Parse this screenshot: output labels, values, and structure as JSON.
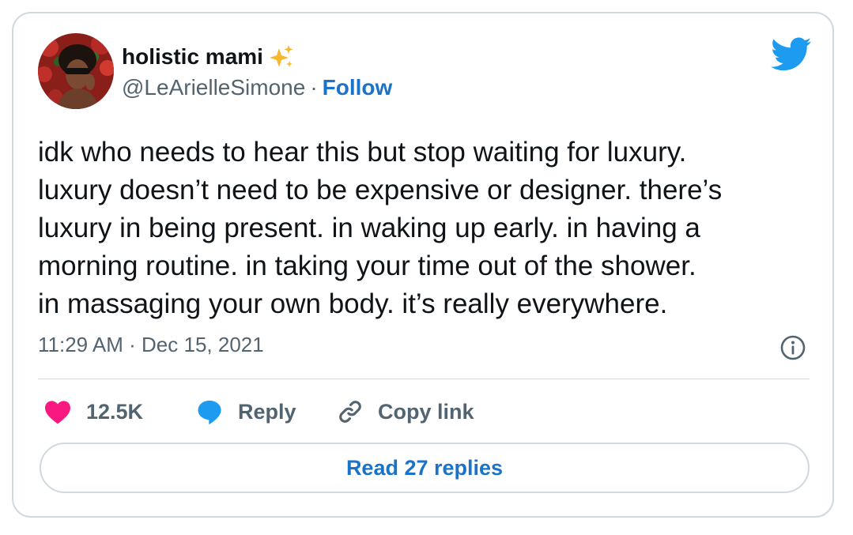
{
  "author": {
    "name": "holistic mami",
    "handle": "@LeArielleSimone",
    "separator": "·",
    "follow_label": "Follow"
  },
  "tweet": {
    "lines": [
      "idk who needs to hear this but stop waiting for luxury.",
      "luxury doesn’t need to be expensive or designer. there’s",
      "luxury in being present. in waking up early. in having a",
      "morning routine. in taking your time out of the shower.",
      "in massaging your own body. it’s really everywhere."
    ],
    "timestamp": "11:29 AM · Dec 15, 2021"
  },
  "actions": {
    "likes": "12.5K",
    "reply_label": "Reply",
    "copy_label": "Copy link"
  },
  "read_replies_label": "Read 27 replies",
  "icons": {
    "avatar": "profile-photo",
    "name_emoji": "sparkles-icon",
    "brand": "twitter-bird-icon",
    "info": "info-icon",
    "like": "heart-icon",
    "reply": "speech-bubble-icon",
    "copy": "link-icon"
  },
  "colors": {
    "text": "#0f1419",
    "secondary": "#536471",
    "link": "#1b73c9",
    "twitter_blue": "#1d9bf0",
    "heart": "#f91880",
    "border": "#cfd9de"
  }
}
